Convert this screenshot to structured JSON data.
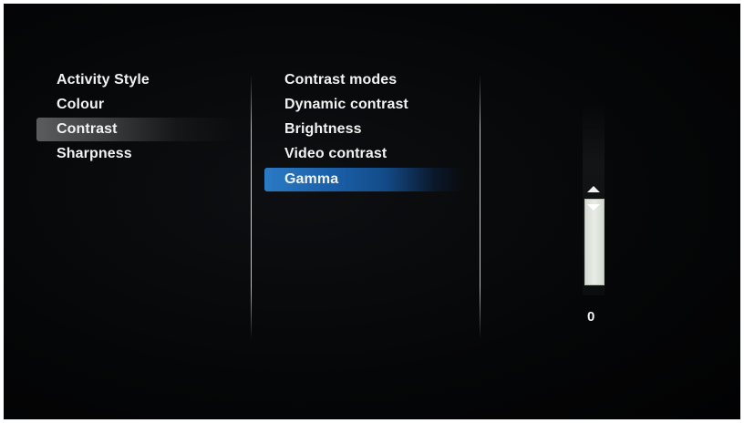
{
  "left_menu": {
    "items": [
      {
        "label": "Activity Style"
      },
      {
        "label": "Colour"
      },
      {
        "label": "Contrast"
      },
      {
        "label": "Sharpness"
      }
    ]
  },
  "sub_menu": {
    "items": [
      {
        "label": "Contrast modes"
      },
      {
        "label": "Dynamic contrast"
      },
      {
        "label": "Brightness"
      },
      {
        "label": "Video contrast"
      },
      {
        "label": "Gamma"
      }
    ]
  },
  "slider": {
    "value": "0",
    "up_icon": "arrow-up-icon",
    "down_icon": "arrow-down-icon"
  },
  "colors": {
    "selected_item": "#1a5fa8",
    "parent_selected_item": "#4a4b4d",
    "background": "#050607",
    "text": "#f2f2f2"
  }
}
